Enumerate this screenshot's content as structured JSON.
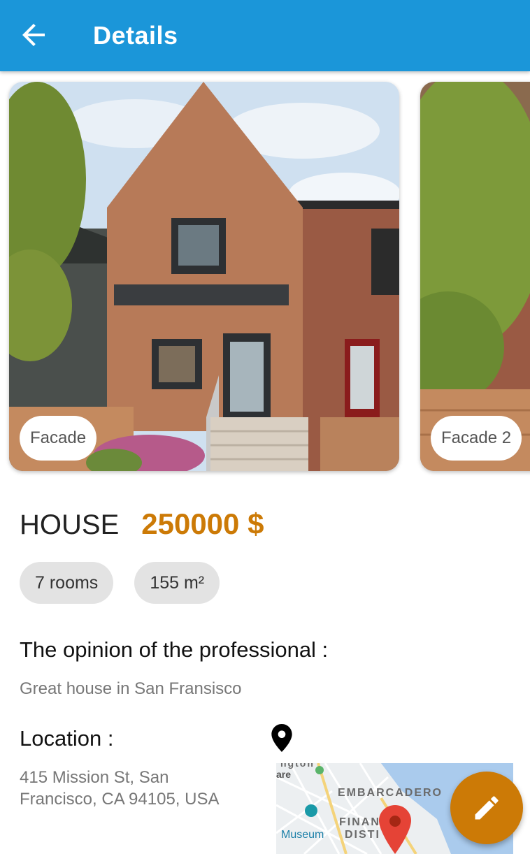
{
  "appbar": {
    "title": "Details",
    "back_icon": "arrow-back-icon",
    "color": "#1b96d9"
  },
  "photos": [
    {
      "label": "Facade"
    },
    {
      "label": "Facade 2"
    }
  ],
  "listing": {
    "type": "HOUSE",
    "price": "250000 $",
    "price_color": "#cc7a06",
    "chips": {
      "rooms": "7 rooms",
      "area": "155 m²"
    }
  },
  "opinion": {
    "heading": "The opinion of the professional :",
    "text": "Great house in San Fransisco"
  },
  "location": {
    "heading": "Location :",
    "address": "415 Mission St, San Francisco, CA 94105, USA",
    "pin_icon": "location-pin-icon",
    "map_labels": {
      "embarcadero": "EMBARCADERO",
      "financial_1": "FINAN",
      "financial_2": "DISTI",
      "museum": "Museum",
      "top_partial_1": "ngton",
      "top_partial_2": "are"
    }
  },
  "fab": {
    "icon": "edit-pencil-icon"
  }
}
